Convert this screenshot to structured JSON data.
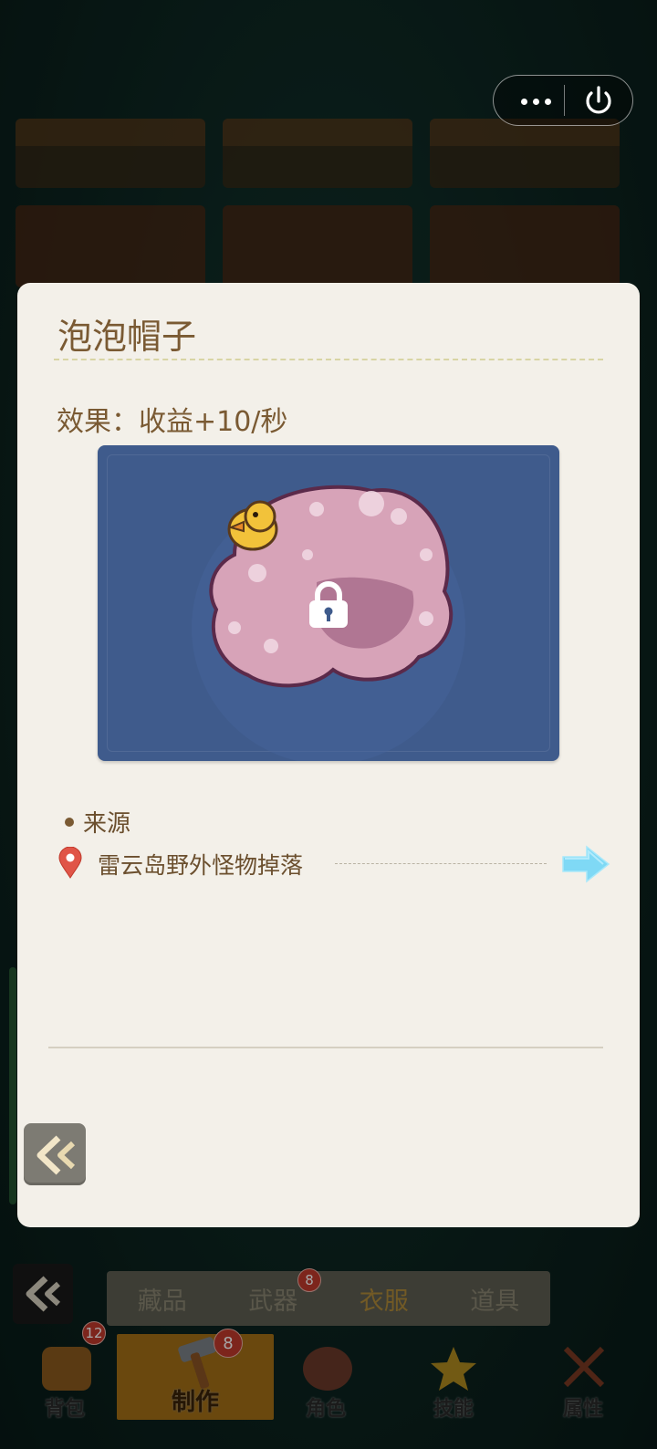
{
  "modal": {
    "title": "泡泡帽子",
    "effect": "效果：收益+10/秒",
    "item_state": "locked",
    "source_label": "来源",
    "source_text": "雷云岛野外怪物掉落"
  },
  "subtabs": [
    {
      "label": "藏品"
    },
    {
      "label": "武器",
      "badge": "8"
    },
    {
      "label": "衣服",
      "active": true
    },
    {
      "label": "道具"
    }
  ],
  "tabbar": [
    {
      "label": "背包",
      "badge": "12"
    },
    {
      "label": "制作",
      "badge": "8",
      "active": true
    },
    {
      "label": "角色"
    },
    {
      "label": "技能"
    },
    {
      "label": "属性"
    }
  ],
  "colors": {
    "modal_bg": "#f3f0e9",
    "title_text": "#7a5a33",
    "item_frame": "#3f5b8c",
    "active_tab": "#a36f16",
    "go_arrow": "#7fd9f5"
  }
}
